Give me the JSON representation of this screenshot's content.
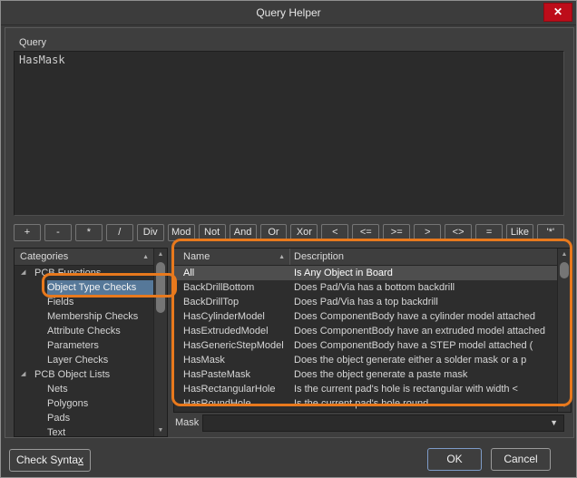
{
  "window": {
    "title": "Query Helper"
  },
  "icons": {
    "close": "✕",
    "sort_asc": "▲",
    "scroll_up": "▲",
    "scroll_down": "▼",
    "combo_arrow": "▼",
    "tree_expanded": "◢"
  },
  "query": {
    "label": "Query",
    "value": "HasMask"
  },
  "operators": [
    "+",
    "-",
    "*",
    "/",
    "Div",
    "Mod",
    "Not",
    "And",
    "Or",
    "Xor",
    "<",
    "<=",
    ">=",
    ">",
    "<>",
    "=",
    "Like",
    "'*'"
  ],
  "categories": {
    "header": "Categories",
    "items": [
      {
        "label": "PCB Functions",
        "level": 0,
        "expanded": true,
        "selected": false
      },
      {
        "label": "Object Type Checks",
        "level": 1,
        "expanded": null,
        "selected": true
      },
      {
        "label": "Fields",
        "level": 1,
        "expanded": null,
        "selected": false
      },
      {
        "label": "Membership Checks",
        "level": 1,
        "expanded": null,
        "selected": false
      },
      {
        "label": "Attribute Checks",
        "level": 1,
        "expanded": null,
        "selected": false
      },
      {
        "label": "Parameters",
        "level": 1,
        "expanded": null,
        "selected": false
      },
      {
        "label": "Layer Checks",
        "level": 1,
        "expanded": null,
        "selected": false
      },
      {
        "label": "PCB Object Lists",
        "level": 0,
        "expanded": true,
        "selected": false
      },
      {
        "label": "Nets",
        "level": 1,
        "expanded": null,
        "selected": false
      },
      {
        "label": "Polygons",
        "level": 1,
        "expanded": null,
        "selected": false
      },
      {
        "label": "Pads",
        "level": 1,
        "expanded": null,
        "selected": false
      },
      {
        "label": "Text",
        "level": 1,
        "expanded": null,
        "selected": false
      }
    ]
  },
  "functions_table": {
    "columns": [
      "Name",
      "Description"
    ],
    "rows": [
      {
        "name": "All",
        "description": "Is Any Object in Board",
        "selected": true
      },
      {
        "name": "BackDrillBottom",
        "description": "Does Pad/Via has a bottom backdrill",
        "selected": false
      },
      {
        "name": "BackDrillTop",
        "description": "Does Pad/Via has a top backdrill",
        "selected": false
      },
      {
        "name": "HasCylinderModel",
        "description": "Does ComponentBody have a cylinder model attached",
        "selected": false
      },
      {
        "name": "HasExtrudedModel",
        "description": "Does ComponentBody have an extruded model attached",
        "selected": false
      },
      {
        "name": "HasGenericStepModel",
        "description": "Does ComponentBody have a STEP model attached (",
        "selected": false
      },
      {
        "name": "HasMask",
        "description": "Does the object generate either a solder mask or a p",
        "selected": false
      },
      {
        "name": "HasPasteMask",
        "description": "Does the object generate a paste mask",
        "selected": false
      },
      {
        "name": "HasRectangularHole",
        "description": "Is the current pad's hole is rectangular with width <",
        "selected": false
      },
      {
        "name": "HasRoundHole",
        "description": "Is the current pad's hole round",
        "selected": false
      }
    ]
  },
  "mask": {
    "label": "Mask",
    "value": ""
  },
  "footer": {
    "check_syntax_prefix": "Check Synta",
    "check_syntax_mnemonic": "x",
    "ok": "OK",
    "cancel": "Cancel"
  },
  "colors": {
    "annotation_orange": "#E8791D",
    "selection_blue": "#567899",
    "selection_gray": "#4E4E4E",
    "close_red": "#BD0D1A",
    "panel_bg": "#2D2D2D",
    "dialog_bg": "#3E3E3E"
  }
}
